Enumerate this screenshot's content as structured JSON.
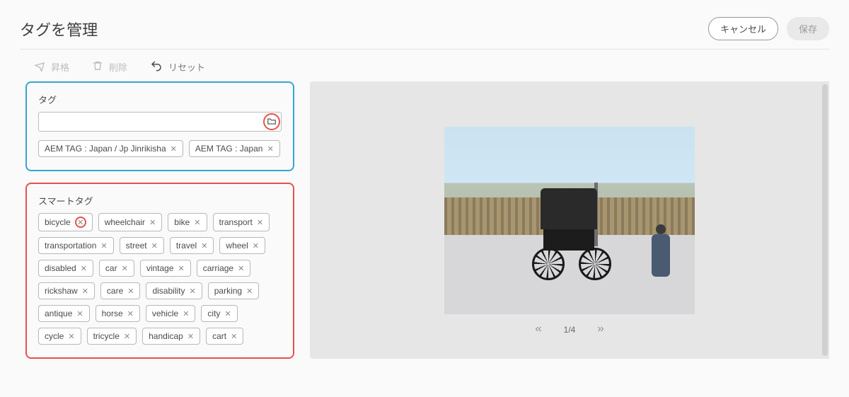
{
  "header": {
    "title": "タグを管理",
    "cancel": "キャンセル",
    "save": "保存"
  },
  "toolbar": {
    "promote": "昇格",
    "delete": "削除",
    "reset": "リセット"
  },
  "tagPanel": {
    "title": "タグ",
    "inputValue": "",
    "tags": [
      "AEM TAG : Japan / Jp Jinrikisha",
      "AEM TAG : Japan"
    ]
  },
  "smartPanel": {
    "title": "スマートタグ",
    "tags": [
      "bicycle",
      "wheelchair",
      "bike",
      "transport",
      "transportation",
      "street",
      "travel",
      "wheel",
      "disabled",
      "car",
      "vintage",
      "carriage",
      "rickshaw",
      "care",
      "disability",
      "parking",
      "antique",
      "horse",
      "vehicle",
      "city",
      "cycle",
      "tricycle",
      "handicap",
      "cart"
    ],
    "circledIndex": 0
  },
  "pager": {
    "label": "1/4"
  }
}
